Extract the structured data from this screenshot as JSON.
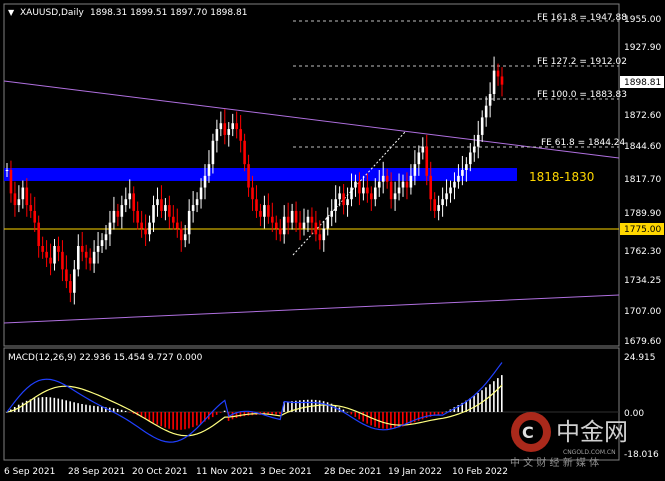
{
  "header": {
    "symbol": "XAUUSD,Daily",
    "ohlc": "1898.31 1899.51 1897.70 1898.81"
  },
  "macd_label": "MACD(12,26,9) 22.936 15.454 9.727 0.000",
  "price_axis": {
    "ticks": [
      "1955.00",
      "1927.90",
      "1872.60",
      "1844.60",
      "1817.70",
      "1789.90",
      "1762.30",
      "1734.25",
      "1707.00",
      "1679.60"
    ],
    "current_price": "1898.81",
    "support_label": "1775.00"
  },
  "macd_axis": {
    "ticks": [
      "24.915",
      "0.00",
      "-18.016"
    ]
  },
  "fe_levels": [
    {
      "label": "FE 161.8 = 1947.88"
    },
    {
      "label": "FE 127.2 = 1912.02"
    },
    {
      "label": "FE 100.0 = 1883.83"
    },
    {
      "label": "FE 61.8 = 1844.24"
    }
  ],
  "zone_label": "1818-1830",
  "date_axis": [
    "6 Sep 2021",
    "28 Sep 2021",
    "20 Oct 2021",
    "11 Nov 2021",
    "3 Dec 2021",
    "28 Dec 2021",
    "19 Jan 2022",
    "10 Feb 2022"
  ],
  "watermark": {
    "brand": "中金网",
    "domain": "CNGOLD.COM.CN",
    "tagline": "中 文 财 经 新 媒 体"
  },
  "colors": {
    "bull": "#ffffff",
    "bear": "#ff0000",
    "zone": "#0000ff",
    "zone_text": "#ffd700",
    "support_line": "#ffd700",
    "trend_line": "#b070e0",
    "macd_signal": "#ffff80",
    "macd_main": "#2040ff"
  }
}
